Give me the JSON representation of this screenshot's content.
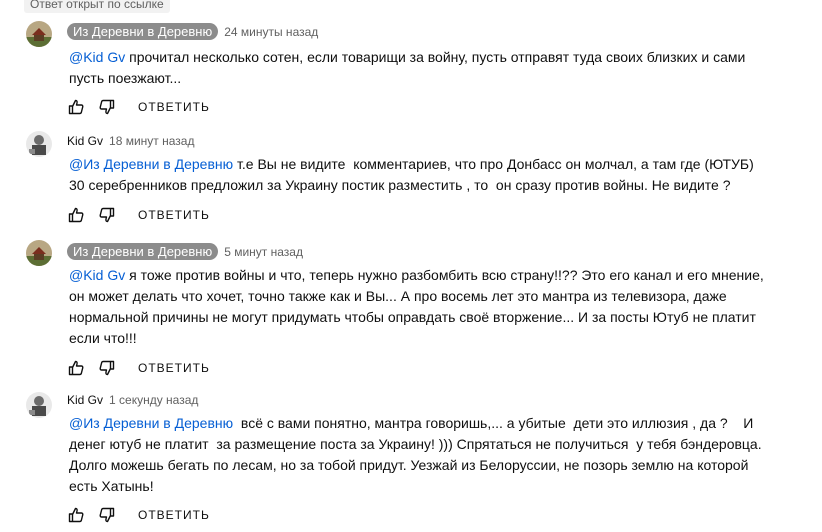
{
  "notice": "Ответ открыт по ссылке",
  "comments": [
    {
      "author": "Из Деревни в Деревню",
      "author_style": "chip",
      "avatar": "village-avatar",
      "time": "24 минуты назад",
      "mention": "@Kid Gv",
      "text": " прочитал несколько сотен, если товарищи за войну, пусть отправят туда своих близких и сами пусть поезжают...",
      "reply_label": "ОТВЕТИТЬ"
    },
    {
      "author": "Kid Gv",
      "author_style": "plain",
      "avatar": "kid-avatar",
      "time": "18 минут назад",
      "mention": "@Из Деревни в Деревню",
      "text": " т.е Вы не видите  комментариев, что про Донбасс он молчал, а там где (ЮТУБ) 30 серебренников предложил за Украину постик разместить , то  он сразу против войны. Не видите ?",
      "reply_label": "ОТВЕТИТЬ"
    },
    {
      "author": "Из Деревни в Деревню",
      "author_style": "chip",
      "avatar": "village-avatar",
      "time": "5 минут назад",
      "mention": "@Kid Gv",
      "text": " я тоже против войны и что, теперь нужно разбомбить всю страну!!?? Это его канал и его мнение, он может делать что хочет, точно также как и Вы... А про восемь лет это мантра из телевизора, даже нормальной причины не могут придумать чтобы оправдать своё вторжение... И за посты Ютуб не платит если что!!!",
      "reply_label": "ОТВЕТИТЬ"
    },
    {
      "author": "Kid Gv",
      "author_style": "plain",
      "avatar": "kid-avatar",
      "time": "1 секунду назад",
      "mention": "@Из Деревни в Деревню",
      "text": "  всё с вами понятно, мантра говоришь,... а убитые  дети это иллюзия , да ?    И денег ютуб не платит  за размещение поста за Украину! ))) Спрятаться не получиться  у тебя бэндеровца. Долго можешь бегать по лесам, но за тобой придут. Уезжай из Белоруссии, не позорь землю на которой есть Хатынь!",
      "reply_label": "ОТВЕТИТЬ"
    }
  ]
}
